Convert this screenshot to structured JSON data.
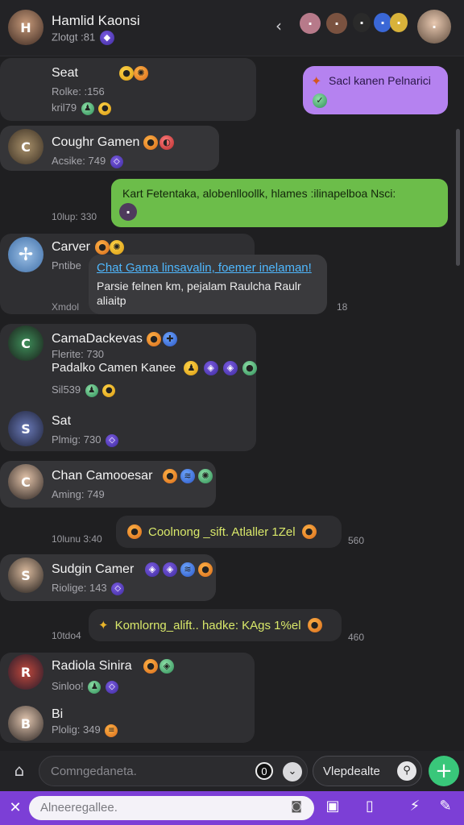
{
  "header": {
    "name": "Hamlid Kaonsi",
    "subtitle": "Zlotgt :81",
    "back_glyph": "‹"
  },
  "messages": [
    {
      "name": "Seat",
      "meta1": "Rolke: :156",
      "meta2": "kril79"
    },
    {
      "name": "Coughr Gamen",
      "meta": "Acsike: 749"
    },
    {
      "name": "Carver",
      "meta": "Pntibe",
      "link": "Chat Gama linsavalin, foemer inelaman!",
      "text": "Parsie felnen km, pejalam Raulcha Raulr aliaitp",
      "left_stamp": "Xmdol",
      "right_stamp": "18"
    },
    {
      "name": "CamaDackevas",
      "meta1": "Flerite: 730",
      "text": "Padalko Camen Kanee",
      "meta2": "Sil539"
    },
    {
      "name": "Sat",
      "meta": "Plmig: 730"
    },
    {
      "name": "Chan Camooesar",
      "meta": "Aming: 749",
      "pill": "Coolnong _sift. Atlaller 1Zel",
      "left_stamp": "10lunu 3:40",
      "right_stamp": "560"
    },
    {
      "name": "Sudgin Camer",
      "meta": "Riolige: 143",
      "pill": "Komlorng_alift.. hadke: KAgs 1%el",
      "left_stamp": "10tdo4",
      "right_stamp": "460"
    },
    {
      "name": "Radiola Sinira",
      "meta": "Sinloo!"
    },
    {
      "name": "Bi",
      "meta": "Plolig: 349"
    }
  ],
  "outgoing": {
    "purple_text": "Sacl kanen Pelnarici",
    "green_text": "Kart Fetentaka, alobenlloollk, hlames :ilinapelboa Nsci:",
    "green_stamp": "10lup: 330"
  },
  "compose": {
    "placeholder": "Comngedaneta.",
    "count": "0",
    "secondary_label": "Vlepdealte"
  },
  "bottom_bar": {
    "placeholder": "Alneeregallee."
  },
  "colors": {
    "accent_purple": "#7c3fd6",
    "green_bubble": "#6cbd4a",
    "purple_bubble": "#b582f0",
    "fab": "#39c77a"
  }
}
